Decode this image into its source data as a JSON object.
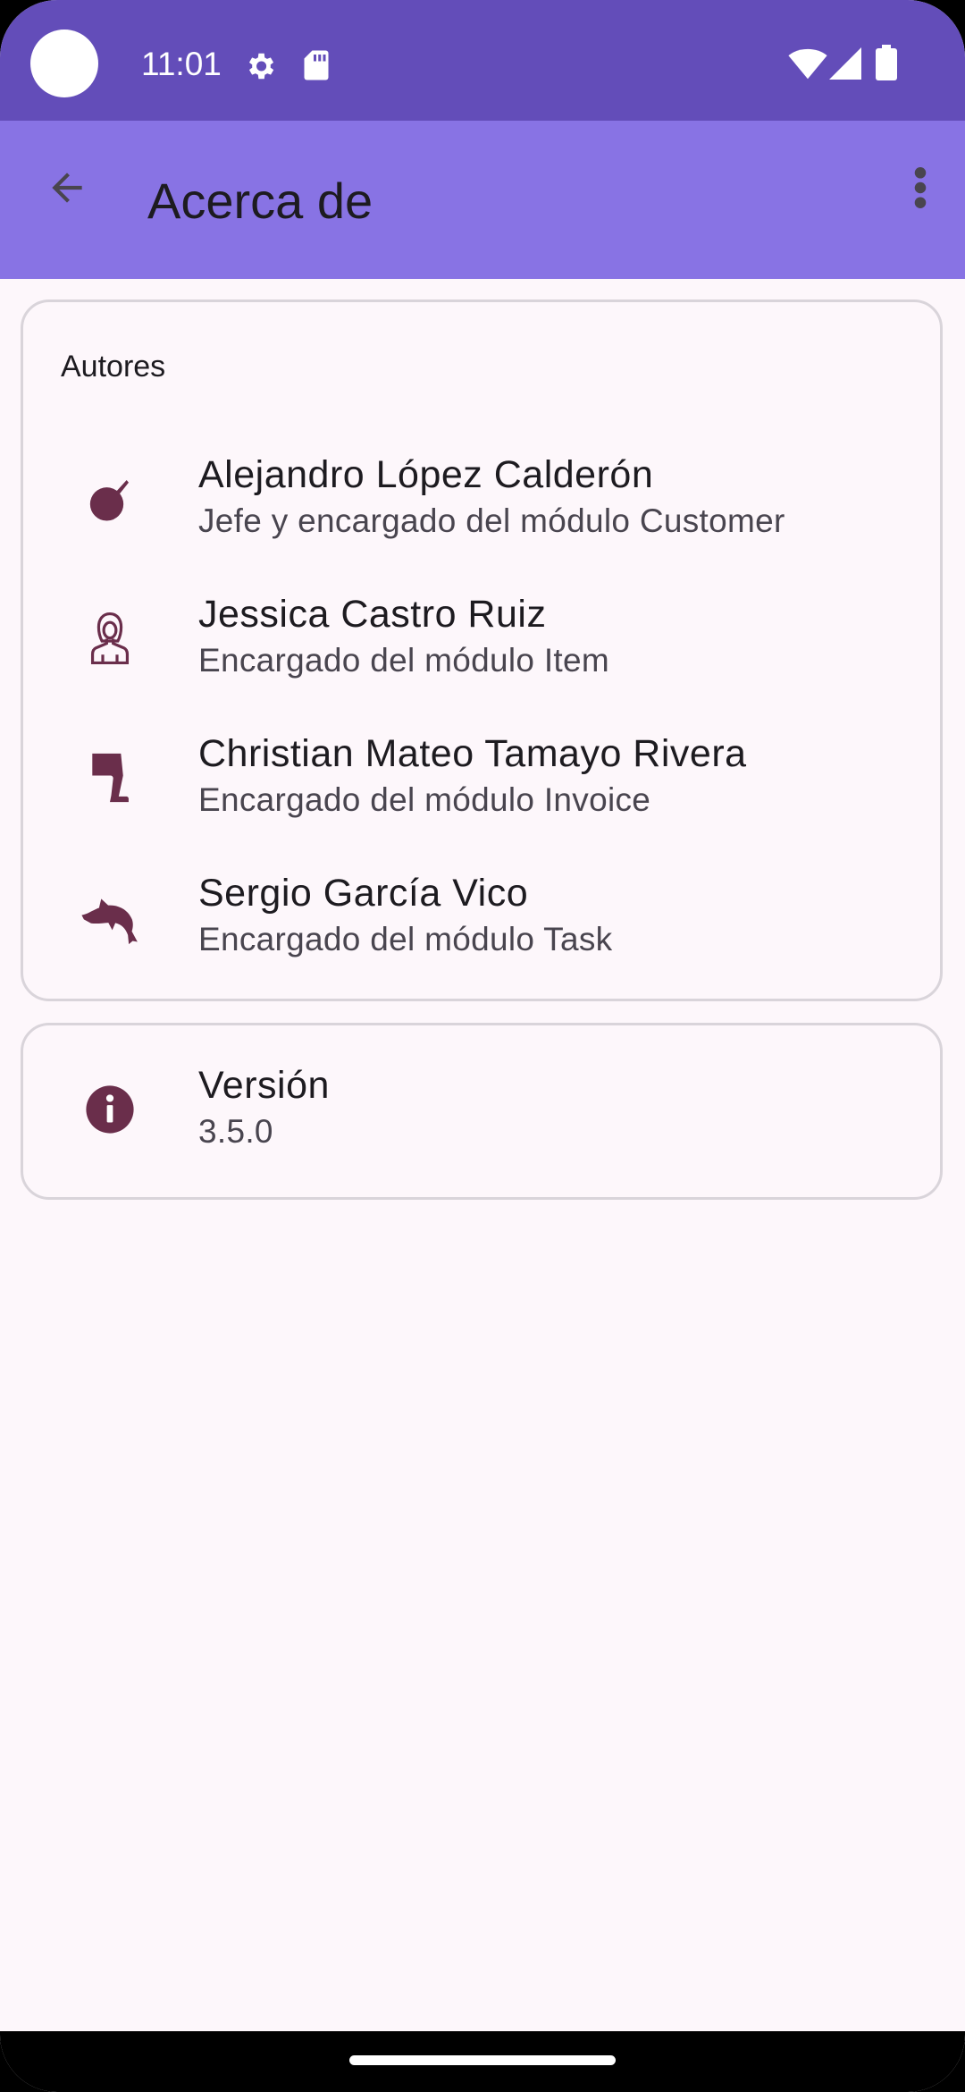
{
  "status_bar": {
    "time": "11:01",
    "icons": [
      "settings-icon",
      "sd-card-icon",
      "wifi-icon",
      "signal-icon",
      "battery-icon"
    ]
  },
  "app_bar": {
    "title": "Acerca de",
    "back_icon": "arrow-back-icon",
    "menu_icon": "more-vert-icon"
  },
  "authors": {
    "header": "Autores",
    "items": [
      {
        "name": "Alejandro López Calderón",
        "role": "Jefe y encargado del módulo Customer",
        "icon": "bomb-icon"
      },
      {
        "name": "Jessica Castro Ruiz",
        "role": "Encargado del módulo Item",
        "icon": "woman-icon"
      },
      {
        "name": "Christian Mateo Tamayo Rivera",
        "role": "Encargado del módulo Invoice",
        "icon": "leg-icon"
      },
      {
        "name": "Sergio García Vico",
        "role": "Encargado del módulo Task",
        "icon": "dolphin-icon"
      }
    ]
  },
  "version": {
    "label": "Versión",
    "value": "3.5.0",
    "icon": "info-icon"
  },
  "colors": {
    "status_bar": "#634db9",
    "app_bar": "#8873e4",
    "icon": "#6a2e4b",
    "background": "#fdf7fb"
  }
}
